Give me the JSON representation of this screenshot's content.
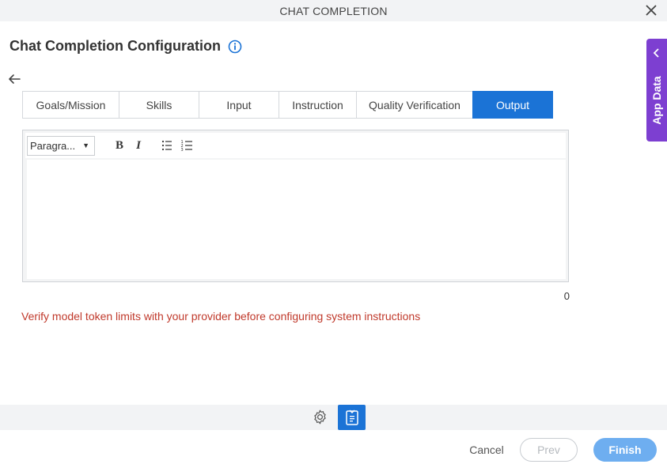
{
  "window": {
    "title": "CHAT COMPLETION"
  },
  "header": {
    "title": "Chat Completion Configuration"
  },
  "tabs": [
    {
      "label": "Goals/Mission",
      "active": false
    },
    {
      "label": "Skills",
      "active": false
    },
    {
      "label": "Input",
      "active": false
    },
    {
      "label": "Instruction",
      "active": false
    },
    {
      "label": "Quality Verification",
      "active": false
    },
    {
      "label": "Output",
      "active": true
    }
  ],
  "editor": {
    "format_select": "Paragra...",
    "content": "",
    "char_count": "0"
  },
  "warning": "Verify model token limits with your provider before configuring system instructions",
  "footer": {
    "cancel_label": "Cancel",
    "prev_label": "Prev",
    "finish_label": "Finish"
  },
  "side_panel": {
    "label": "App Data"
  },
  "colors": {
    "accent": "#1b73d6",
    "side_panel": "#7d3fd1",
    "warning": "#c0392b",
    "finish_disabled": "#6eaef0"
  },
  "icons": [
    "close-icon",
    "info-icon",
    "back-arrow-icon",
    "bold-icon",
    "italic-icon",
    "bullet-list-icon",
    "numbered-list-icon",
    "gear-icon",
    "data-mapping-icon",
    "chevron-left-icon"
  ]
}
